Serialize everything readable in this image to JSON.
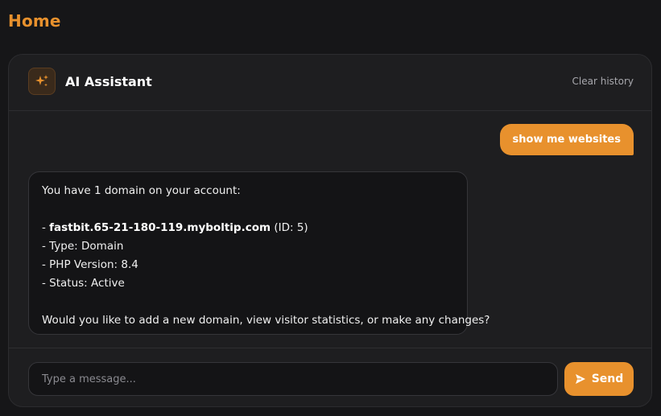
{
  "page": {
    "title": "Home"
  },
  "assistant": {
    "title": "AI Assistant",
    "clear_history_label": "Clear history",
    "icon": "sparkles-icon"
  },
  "messages": {
    "user_message": "show me websites",
    "reply": {
      "intro": "You have 1 domain on your account:",
      "domain_prefix": "- ",
      "domain_name": "fastbit.65-21-180-119.myboltip.com",
      "domain_id": " (ID: 5)",
      "type": "- Type: Domain",
      "php_version": "- PHP Version: 8.4",
      "status": "- Status: Active",
      "question": "Would you like to add a new domain, view visitor statistics, or make any changes?"
    }
  },
  "composer": {
    "placeholder": "Type a message...",
    "send_label": "Send",
    "send_icon": "send-icon"
  },
  "colors": {
    "accent": "#e8912d",
    "background": "#161618",
    "card": "#1e1e20"
  }
}
